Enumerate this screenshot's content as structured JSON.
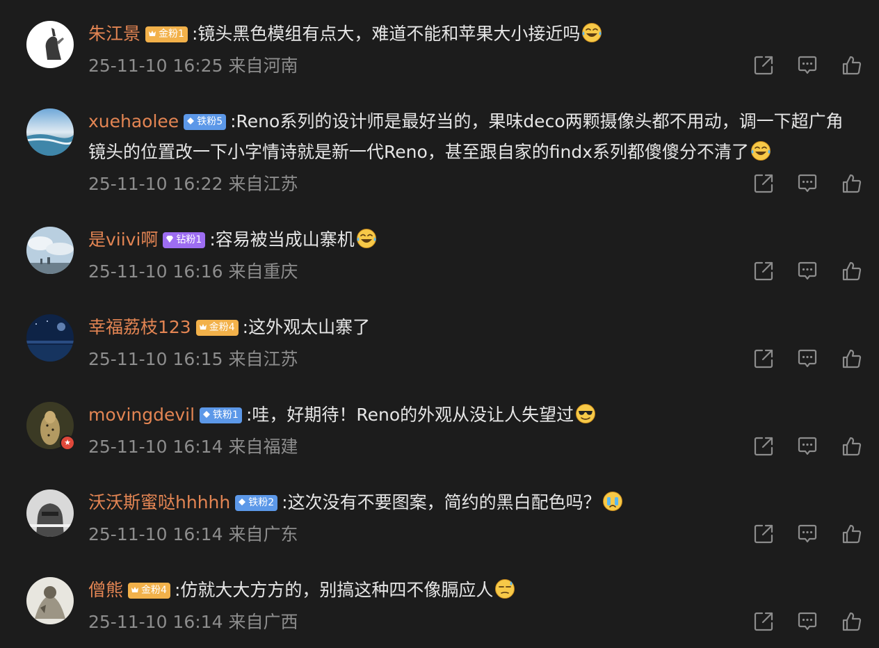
{
  "comments": [
    {
      "username": "朱江景",
      "badge": "金粉1",
      "badge_type": "gold",
      "text": ":镜头黑色模组有点大，难道不能和苹果大小接近吗",
      "emoji": "laugh-cry-emoji",
      "time": "25-11-10 16:25",
      "location": "来自河南"
    },
    {
      "username": "xuehaolee",
      "badge": "铁粉5",
      "badge_type": "iron",
      "text": ":Reno系列的设计师是最好当的，果味deco两颗摄像头都不用动，调一下超广角镜头的位置改一下小字情诗就是新一代Reno，甚至跟自家的findx系列都傻傻分不清了",
      "emoji": "laugh-cry-emoji",
      "time": "25-11-10 16:22",
      "location": "来自江苏"
    },
    {
      "username": "是viivi啊",
      "badge": "钻粉1",
      "badge_type": "diamond",
      "text": ":容易被当成山寨机",
      "emoji": "laugh-cry-emoji",
      "time": "25-11-10 16:16",
      "location": "来自重庆"
    },
    {
      "username": "幸福荔枝123",
      "badge": "金粉4",
      "badge_type": "gold",
      "text": ":这外观太山寨了",
      "emoji": "",
      "time": "25-11-10 16:15",
      "location": "来自江苏"
    },
    {
      "username": "movingdevil",
      "badge": "铁粉1",
      "badge_type": "iron",
      "text": ":哇，好期待！Reno的外观从没让人失望过",
      "emoji": "sunglasses-emoji",
      "time": "25-11-10 16:14",
      "location": "来自福建"
    },
    {
      "username": "沃沃斯蜜哒hhhhh",
      "badge": "铁粉2",
      "badge_type": "iron",
      "text": ":这次没有不要图案，简约的黑白配色吗？",
      "emoji": "crying-emoji",
      "time": "25-11-10 16:14",
      "location": "来自广东"
    },
    {
      "username": "僧熊",
      "badge": "金粉4",
      "badge_type": "gold",
      "text": ":仿就大大方方的，别搞这种四不像膈应人",
      "emoji": "unamused-sweat-emoji",
      "time": "25-11-10 16:14",
      "location": "来自广西"
    }
  ],
  "colors": {
    "background": "#1c1c1c",
    "username": "#e38553",
    "text": "#e6e6e6",
    "meta": "#8d8d8d",
    "gold_badge": "#f2b14a",
    "iron_badge": "#5c98e8",
    "diamond_badge": "#9d6df2"
  },
  "icons": [
    "share-icon",
    "comment-icon",
    "like-icon"
  ]
}
